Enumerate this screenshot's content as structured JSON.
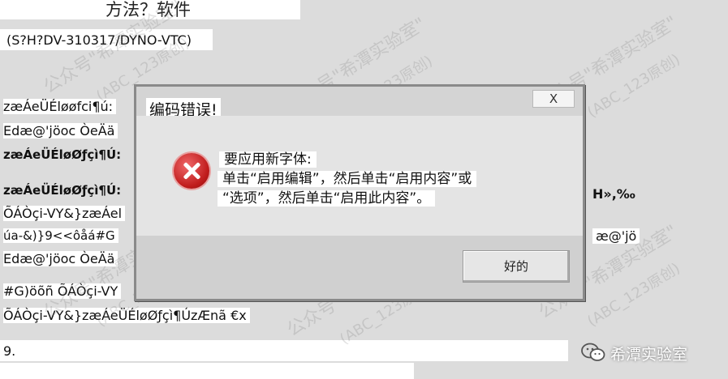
{
  "document": {
    "title": "方法？软件",
    "subtitle": "(S?H?DV-310317/DYNO-VTC)",
    "lines": [
      "zæÁeÜÉløøfci¶ú:",
      "Edæ@'jöoc ÒeÄä",
      "zæÁeÜÉløØƒçì¶Ú:",
      "zæÁeÜÉløØƒçì¶Ú:",
      "ÕÁÒçi-VY&}zæÁel",
      "úa-&)}9<<ôåá#G",
      "Edæ@'jöoc ÒeÄä",
      "#G)öõñ ÕÁÒçi-VY",
      "ÕÁÒçi-VY&}zæÁeÜÉløØƒçì¶ÚzÆnã €x",
      "9."
    ],
    "right_fragments": [
      "H»,‰",
      "æ@'jö"
    ]
  },
  "dialog": {
    "title": "编码错误!",
    "close_label": "X",
    "message_line1": "要应用新字体:",
    "message_line2": "单击“启用编辑”，然后单击“启用内容”或",
    "message_line3": "“选项”，然后单击“启用此内容”。",
    "ok_label": "好的",
    "icon": "error-icon"
  },
  "watermark": {
    "text_line1": "公众号\"希潭实验室\"",
    "text_line2": "(ABC_123原创)"
  },
  "brand": {
    "icon": "wechat-icon",
    "name": "希潭实验室"
  },
  "colors": {
    "error_red": "#c01c1c",
    "dialog_bg": "#d4d4d4"
  }
}
